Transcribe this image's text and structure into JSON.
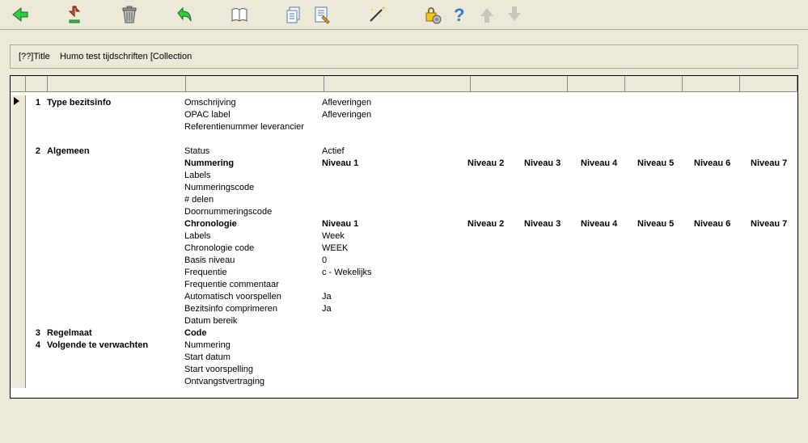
{
  "titlebar": {
    "prefix": "[??]Title",
    "text": "Humo test tijdschriften [Collection"
  },
  "icons": {
    "back": "back-arrow-icon",
    "down": "download-icon",
    "trash": "trash-icon",
    "undo": "undo-icon",
    "book": "book-icon",
    "copy": "copy-icon",
    "edit": "edit-doc-icon",
    "wand": "wand-icon",
    "lock": "lock-settings-icon",
    "help": "help-icon",
    "up": "nav-up-icon",
    "downnav": "nav-down-icon"
  },
  "levels": {
    "lv1": "Niveau 1",
    "lv2": "Niveau 2",
    "lv3": "Niveau 3",
    "lv4": "Niveau 4",
    "lv5": "Niveau 5",
    "lv6": "Niveau 6",
    "lv7": "Niveau 7"
  },
  "rows": {
    "n1": "1",
    "n2": "2",
    "n3": "3",
    "n4": "4",
    "sec1": "Type bezitsinfo",
    "sec2": "Algemeen",
    "sec3": "Regelmaat",
    "sec4": "Volgende te verwachten",
    "l_omschrijving": "Omschrijving",
    "v_omschrijving": "Afleveringen",
    "l_opac": "OPAC label",
    "v_opac": "Afleveringen",
    "l_ref": "Referentienummer leverancier",
    "l_status": "Status",
    "v_status": "Actief",
    "l_nummering": "Nummering",
    "l_labels": "Labels",
    "l_numcode": "Nummeringscode",
    "l_delen": "# delen",
    "l_doornum": "Doornummeringscode",
    "l_chronologie": "Chronologie",
    "l_labels2": "Labels",
    "v_labels2": "Week",
    "l_chroncode": "Chronologie code",
    "v_chroncode": "WEEK",
    "l_basis": "Basis niveau",
    "v_basis": "0",
    "l_freq": "Frequentie",
    "v_freq": "c - Wekelijks",
    "l_freqcom": "Frequentie commentaar",
    "l_autov": "Automatisch voorspellen",
    "v_autov": "Ja",
    "l_bezcomp": "Bezitsinfo comprimeren",
    "v_bezcomp": "Ja",
    "l_datumb": "Datum bereik",
    "l_code": "Code",
    "l_num2": "Nummering",
    "l_startd": "Start datum",
    "l_startv": "Start voorspelling",
    "l_ontv": "Ontvangstvertraging"
  }
}
